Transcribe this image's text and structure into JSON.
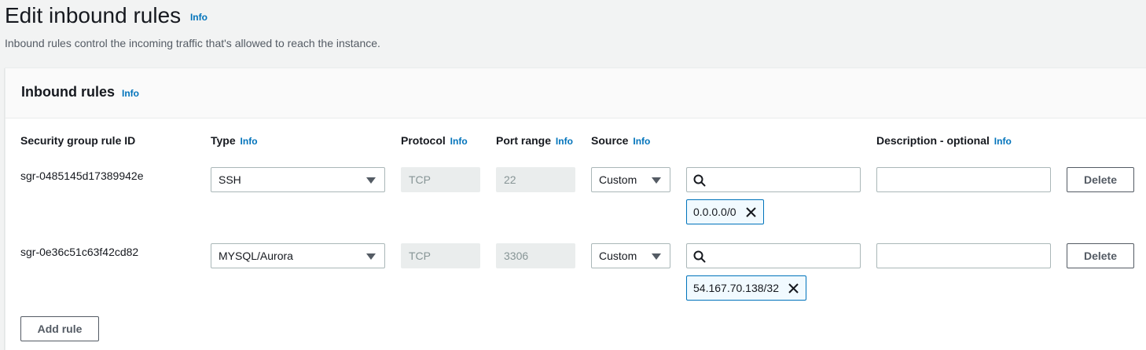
{
  "page": {
    "title": "Edit inbound rules",
    "title_info": "Info",
    "description": "Inbound rules control the incoming traffic that's allowed to reach the instance."
  },
  "panel": {
    "title": "Inbound rules",
    "title_info": "Info"
  },
  "columns": {
    "rule_id": "Security group rule ID",
    "type": "Type",
    "protocol": "Protocol",
    "port_range": "Port range",
    "source": "Source",
    "description": "Description - optional",
    "info": "Info"
  },
  "rules": [
    {
      "rule_id": "sgr-0485145d17389942e",
      "type": "SSH",
      "protocol": "TCP",
      "port_range": "22",
      "source_type": "Custom",
      "source_search_value": "",
      "source_token": "0.0.0.0/0",
      "description": "",
      "delete_label": "Delete"
    },
    {
      "rule_id": "sgr-0e36c51c63f42cd82",
      "type": "MYSQL/Aurora",
      "protocol": "TCP",
      "port_range": "3306",
      "source_type": "Custom",
      "source_search_value": "",
      "source_token": "54.167.70.138/32",
      "description": "",
      "delete_label": "Delete"
    }
  ],
  "actions": {
    "add_rule_label": "Add rule"
  },
  "colors": {
    "page_background": "#f2f3f3",
    "info_link": "#0073bb",
    "token_border": "#0073bb",
    "disabled_field": "#eaeded"
  },
  "icons": {
    "search": "search-icon",
    "dropdown": "caret-down-icon",
    "remove": "close-icon"
  }
}
